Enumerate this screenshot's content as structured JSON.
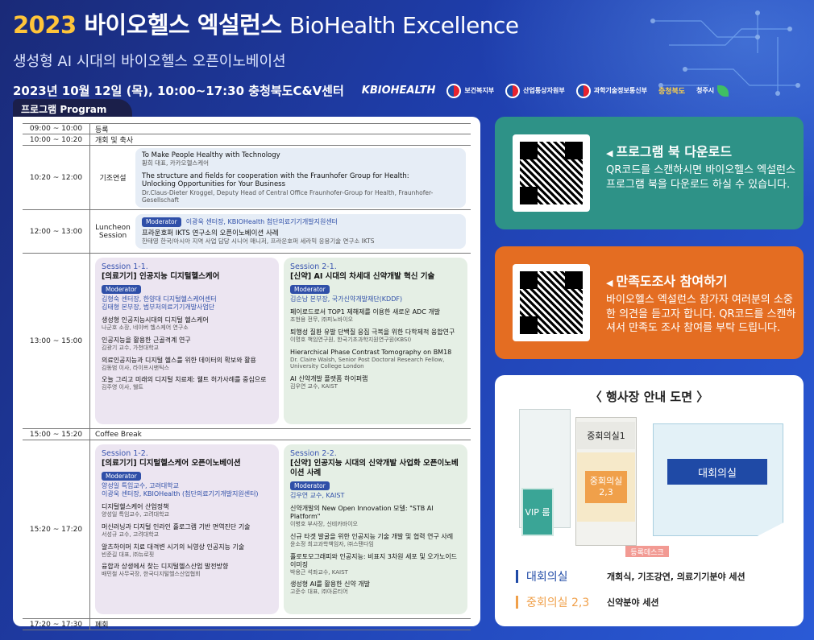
{
  "header": {
    "year": "2023",
    "title_ko": "바이오헬스 엑설런스",
    "title_en": "BioHealth Excellence",
    "subtitle": "생성형 AI 시대의 바이오헬스 오픈이노베이션",
    "date": "2023년 10월 12일 (목), 10:00~17:30 충청북도C&V센터",
    "logos": {
      "kbio": "KBIOHEALTH",
      "mohw": "보건복지부",
      "motie": "산업통상자원부",
      "msit": "과학기술정보통신부",
      "chungbuk": "충청북도",
      "cheongju": "청주시"
    }
  },
  "program": {
    "tab_label": "프로그램 Program",
    "registration": {
      "time": "09:00 ~ 10:00",
      "label": "등록"
    },
    "opening": {
      "time": "10:00 ~ 10:20",
      "label": "개회 및 축사"
    },
    "keynote": {
      "time": "10:20 ~ 12:00",
      "label": "기조연설",
      "talk1_title": "To Make People Healthy with Technology",
      "talk1_speaker": "황희 대표, 카카오헬스케어",
      "talk2_title_1": "The structure and fields for cooperation with the Fraunhofer Group for Health:",
      "talk2_title_2": "Unlocking Opportunities for Your Business",
      "talk2_speaker": "Dr.Claus-Dieter Kroggel, Deputy Head of Central Office Fraunhofer-Group for Health, Fraunhofer-Gesellschaft"
    },
    "lunch": {
      "time": "12:00 ~ 13:00",
      "label_1": "Luncheon",
      "label_2": "Session",
      "moderator_tag": "Moderator",
      "moderator": "이광욱 센터장, KBIOHealth 첨단의료기기개발지원센터",
      "talk_title": "프라운호퍼 IKTS 연구소의 오픈이노베이션 사례",
      "talk_speaker": "한태영 한국/아시아 지역 사업 담당 시니어 매니저, 프라운호퍼 세라믹 응용기술 연구소 IKTS"
    },
    "session1": {
      "time": "13:00 ~ 15:00",
      "left": {
        "num": "Session 1-1.",
        "title": "[의료기기] 인공지능 디지털헬스케어",
        "moderator_tag": "Moderator",
        "mod1": "김형숙 센터장, 한양대 디지털헬스케어센터",
        "mod2": "김태형 본부장, 범부처의료기기개발사업단",
        "talks": [
          {
            "title": "생성형 인공지능시대의 디지털 헬스케어",
            "speaker": "나군호 소장, 네이버 헬스케어 연구소"
          },
          {
            "title": "인공지능을 활용한 근골격계 연구",
            "speaker": "김광기 교수, 가천대학교"
          },
          {
            "title": "의료인공지능과 디지털 헬스를 위한 데이터의 확보와 활용",
            "speaker": "김동범 이사, 라이프시맨틱스"
          },
          {
            "title": "오늘 그리고 미래의 디지털 치료제: 웰트 허가사례를 중심으로",
            "speaker": "김주영 이사, 웰트"
          }
        ]
      },
      "right": {
        "num": "Session 2-1.",
        "title": "[신약] AI 시대의 차세대 신약개발 혁신 기술",
        "moderator_tag": "Moderator",
        "mod1": "김순남 본부장, 국가신약개발재단(KDDF)",
        "talks": [
          {
            "title": "페이로드로서 TOP1 제해제를 이용한 새로운 ADC 개발",
            "speaker": "조현용 전무, ㈜피노바이오"
          },
          {
            "title": "퇴행성 질환 유발 단백질 응집 극복을 위한 다학제적 융합연구",
            "speaker": "이명호 책임연구원, 한국기초과학지원연구원(KBSI)"
          },
          {
            "title": "Hierarchical Phase Contrast Tomography on BM18",
            "speaker": "Dr. Claire Walsh, Senior Post Doctoral Research Fellow, University College London"
          },
          {
            "title": "AI 신약개발 플랫폼 하이퍼랩",
            "speaker": "김우연 교수, KAIST"
          }
        ]
      }
    },
    "coffee": {
      "time": "15:00 ~ 15:20",
      "label": "Coffee Break"
    },
    "session2": {
      "time": "15:20 ~ 17:20",
      "left": {
        "num": "Session 1-2.",
        "title": "[의료기기] 디지털헬스케어 오픈이노베이션",
        "moderator_tag": "Moderator",
        "mod1": "양성일 특임교수, 고려대학교",
        "mod2": "이광욱 센터장, KBIOHealth (첨단의료기기개발지원센터)",
        "talks": [
          {
            "title": "디지털헬스케어 산업정책",
            "speaker": "양성일 특임교수, 고려대학교"
          },
          {
            "title": "머신러닝과 디지털 인라인 홀로그램 기반 면역진단 기술",
            "speaker": "서성규 교수, 고려대학교"
          },
          {
            "title": "알츠하이머 치료 대격변 시기의 뇌영상 인공지능 기술",
            "speaker": "빈준길 대표, ㈜뉴로핏"
          },
          {
            "title": "융합과 상생에서 찾는 디지털헬스산업 발전방향",
            "speaker": "배민철 사무국장, 한국디지털헬스산업협회"
          }
        ]
      },
      "right": {
        "num": "Session 2-2.",
        "title": "[신약] 인공지능 시대의 신약개발 사업화 오픈이노베이션 사례",
        "moderator_tag": "Moderator",
        "mod1": "김우연 교수, KAIST",
        "talks": [
          {
            "title": "신약개발의 New Open Innovation 모델: \"STB AI Platform\"",
            "speaker": "이병호 부사장, 신테카바이오"
          },
          {
            "title": "신규 타겟 발굴을 위한 인공지능 기술 개발 및 협력 연구 사례",
            "speaker": "윤소정 최고과학책임자, ㈜스탠다임"
          },
          {
            "title": "홀로토모그래피와 인공지능: 비표지 3차원 세포 및 오가노이드 이미징",
            "speaker": "박용근 석좌교수, KAIST"
          },
          {
            "title": "생성형 AI를 활용한 신약 개발",
            "speaker": "고준수 대표, ㈜아론티어"
          }
        ]
      }
    },
    "closing": {
      "time": "17:20 ~ 17:30",
      "label": "폐회"
    }
  },
  "cards": {
    "download": {
      "title": "프로그램 북 다운로드",
      "body": "QR코드를 스캔하시면 바이오헬스 엑설런스 프로그램 북을 다운로드 하실 수 있습니다."
    },
    "survey": {
      "title": "만족도조사 참여하기",
      "body": "바이오헬스 엑설런스 참가자 여러분의 소중한 의견을 듣고자 합니다. QR코드를 스캔하셔서 만족도 조사 참여를 부탁 드립니다."
    }
  },
  "map": {
    "title": "〈  행사장 안내 도면  〉",
    "room_med1": "중회의실1",
    "room_med23": "중회의실 2,3",
    "room_vip": "VIP 룸",
    "room_main": "대회의실",
    "registration": "등록데스크",
    "legend": [
      {
        "name": "대회의실",
        "desc": "개회식, 기조강연, 의료기기분야 세션",
        "color": "#1f4aa6"
      },
      {
        "name": "중회의실 2,3",
        "desc": "신약분야 세션",
        "color": "#f0a04a"
      }
    ]
  },
  "colors": {
    "accent_yellow": "#ffc53a",
    "teal": "#2e9287",
    "orange": "#e46d22",
    "navy": "#1b1f4a",
    "blue": "#1f4aa6"
  }
}
